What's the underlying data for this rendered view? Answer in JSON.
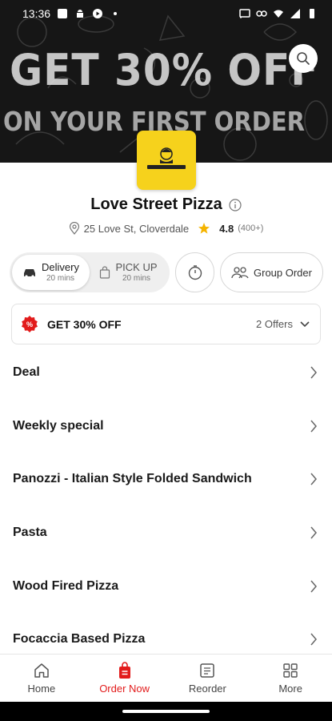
{
  "status_bar": {
    "time": "13:36"
  },
  "hero": {
    "headline": "GET 30% OFF",
    "subheadline": "ON YOUR FIRST ORDER"
  },
  "store": {
    "name": "Love Street Pizza",
    "address": "25 Love St, Cloverdale",
    "rating": "4.8",
    "rating_count": "(400+)"
  },
  "modes": {
    "delivery_label": "Delivery",
    "delivery_time": "20 mins",
    "pickup_label": "PICK UP",
    "pickup_time": "20 mins"
  },
  "group_order_label": "Group Order",
  "offer": {
    "badge": "%",
    "title": "GET 30% OFF",
    "count": "2 Offers"
  },
  "menu": [
    {
      "label": "Deal"
    },
    {
      "label": "Weekly special"
    },
    {
      "label": "Panozzi - Italian Style Folded Sandwich"
    },
    {
      "label": "Pasta"
    },
    {
      "label": "Wood Fired Pizza"
    },
    {
      "label": "Focaccia Based Pizza"
    }
  ],
  "nav": {
    "home": "Home",
    "order_now": "Order Now",
    "reorder": "Reorder",
    "more": "More"
  },
  "colors": {
    "accent": "#e21b1b",
    "logo_bg": "#f6d21c",
    "star": "#f5b400"
  }
}
